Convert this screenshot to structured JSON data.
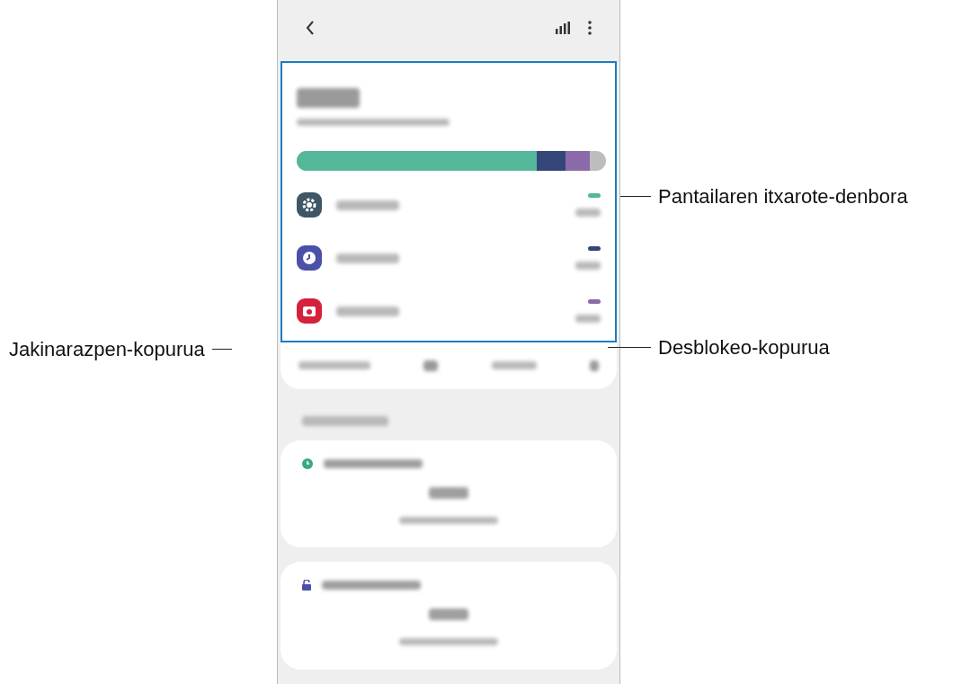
{
  "callouts": [
    {
      "label": "Pantailaren itxarote-denbora",
      "kind": "right"
    },
    {
      "label": "Jakinarazpen-kopurua",
      "kind": "left"
    },
    {
      "label": "Desblokeo-kopurua",
      "kind": "right"
    }
  ],
  "apps": [
    {
      "kind": "gear",
      "color": "#55b79a"
    },
    {
      "kind": "clock",
      "color": "#34457a"
    },
    {
      "kind": "camera",
      "color": "#8a6aa8"
    }
  ],
  "goals": [
    {
      "kind": "clock"
    },
    {
      "kind": "lock"
    }
  ]
}
